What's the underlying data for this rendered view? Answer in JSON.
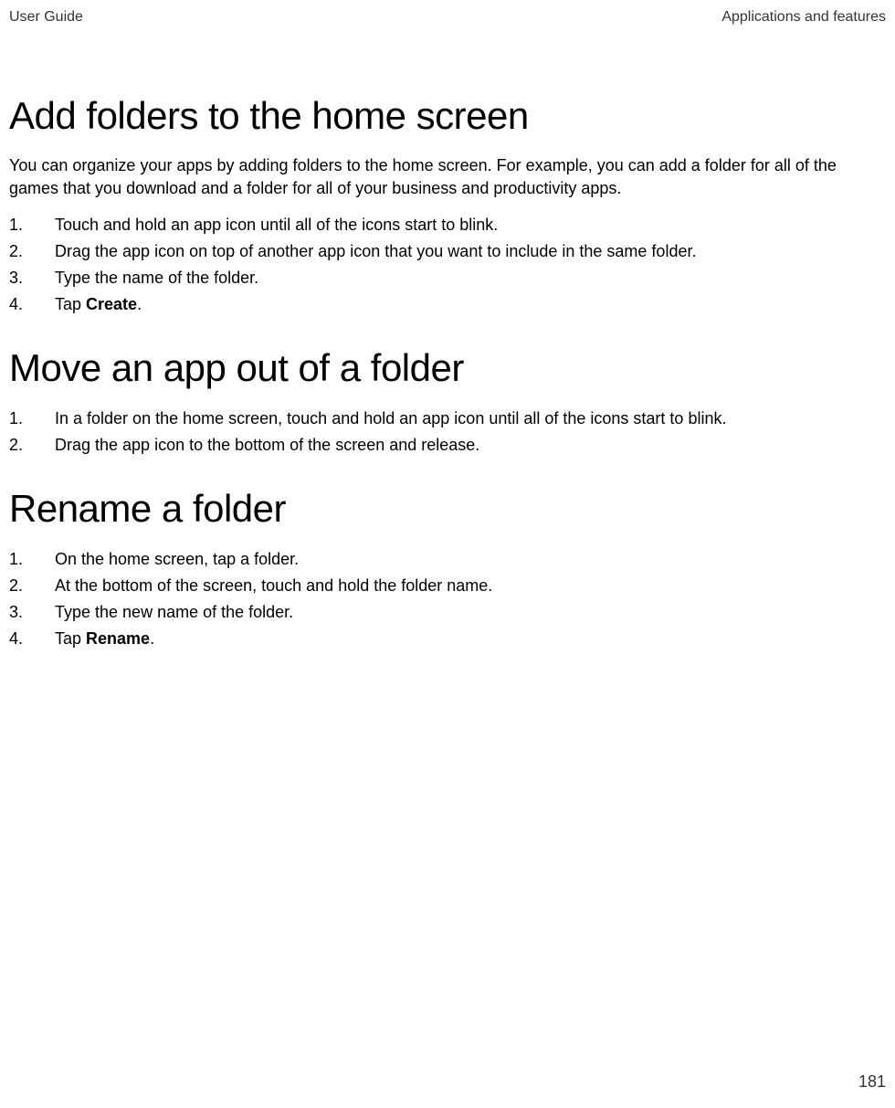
{
  "header": {
    "left": "User Guide",
    "right": "Applications and features"
  },
  "sections": [
    {
      "title": "Add folders to the home screen",
      "intro": "You can organize your apps by adding folders to the home screen. For example, you can add a folder for all of the games that you download and a folder for all of your business and productivity apps.",
      "steps": [
        {
          "text": "Touch and hold an app icon until all of the icons start to blink."
        },
        {
          "text": "Drag the app icon on top of another app icon that you want to include in the same folder."
        },
        {
          "text": "Type the name of the folder."
        },
        {
          "prefix": "Tap ",
          "bold": "Create",
          "suffix": "."
        }
      ]
    },
    {
      "title": "Move an app out of a folder",
      "steps": [
        {
          "text": "In a folder on the home screen, touch and hold an app icon until all of the icons start to blink."
        },
        {
          "text": "Drag the app icon to the bottom of the screen and release."
        }
      ]
    },
    {
      "title": "Rename a folder",
      "steps": [
        {
          "text": "On the home screen, tap a folder."
        },
        {
          "text": "At the bottom of the screen, touch and hold the folder name."
        },
        {
          "text": "Type the new name of the folder."
        },
        {
          "prefix": "Tap ",
          "bold": "Rename",
          "suffix": "."
        }
      ]
    }
  ],
  "pageNumber": "181"
}
